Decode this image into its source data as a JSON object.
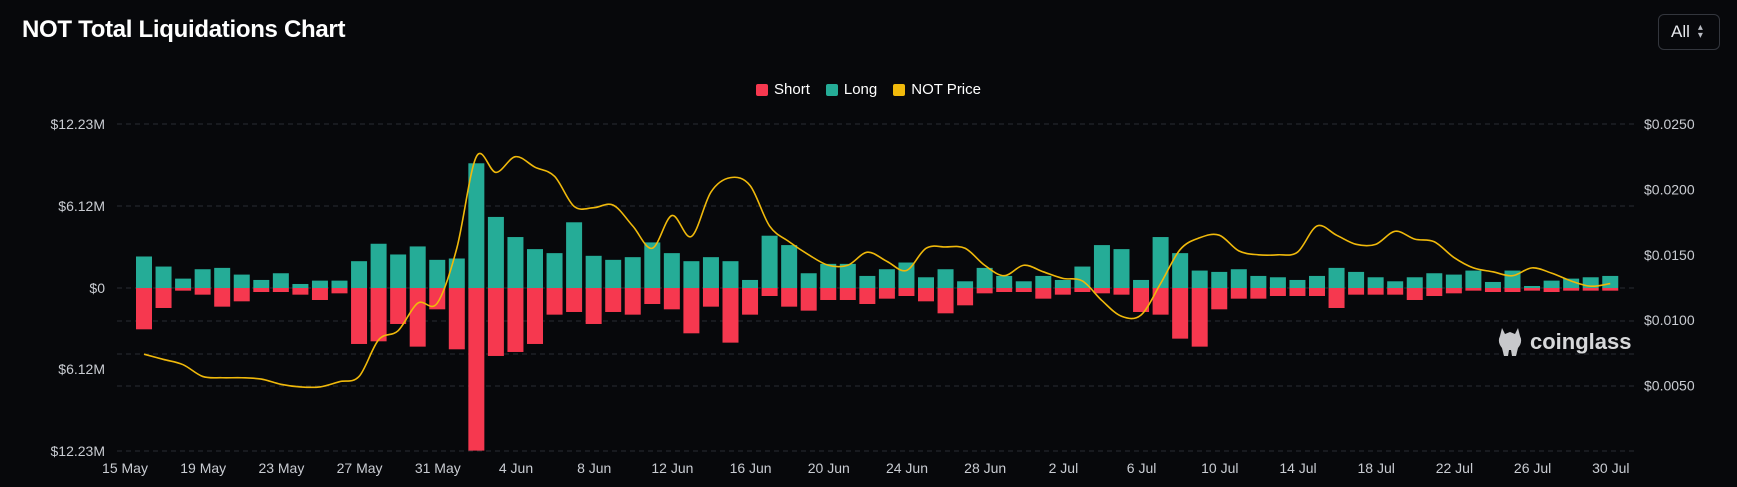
{
  "header": {
    "title": "NOT Total Liquidations Chart"
  },
  "range_select": {
    "value": "All"
  },
  "legend": [
    {
      "label": "Short",
      "color": "#f6384f"
    },
    {
      "label": "Long",
      "color": "#25ac97"
    },
    {
      "label": "NOT Price",
      "color": "#f0b90b"
    }
  ],
  "watermark": {
    "text": "coinglass"
  },
  "chart_data": {
    "type": "bar",
    "y_left": {
      "ticks": [
        "$12.23M",
        "$6.12M",
        "$0",
        "$6.12M",
        "$12.23M"
      ],
      "range": [
        -12.23,
        12.23
      ],
      "unit": "M USD"
    },
    "y_right": {
      "ticks": [
        "$0.0250",
        "$0.0200",
        "$0.0150",
        "$0.0100",
        "$0.0050"
      ],
      "range": [
        0.0,
        0.025
      ]
    },
    "x_ticks": [
      "15 May",
      "19 May",
      "23 May",
      "27 May",
      "31 May",
      "4 Jun",
      "8 Jun",
      "12 Jun",
      "16 Jun",
      "20 Jun",
      "24 Jun",
      "28 Jun",
      "2 Jul",
      "6 Jul",
      "10 Jul",
      "14 Jul",
      "18 Jul",
      "22 Jul",
      "26 Jul",
      "30 Jul"
    ],
    "x_tick_index": [
      0,
      4,
      8,
      12,
      16,
      20,
      24,
      28,
      32,
      36,
      40,
      44,
      48,
      52,
      56,
      60,
      64,
      68,
      72,
      76
    ],
    "series": [
      {
        "name": "Long",
        "color": "#25ac97",
        "values": [
          2.35,
          1.6,
          0.7,
          1.4,
          1.5,
          1.0,
          0.6,
          1.1,
          0.3,
          0.55,
          0.55,
          2.0,
          3.3,
          2.5,
          3.1,
          2.1,
          2.2,
          9.3,
          5.3,
          3.8,
          2.9,
          2.6,
          4.9,
          2.4,
          2.1,
          2.3,
          3.4,
          2.6,
          2.0,
          2.3,
          2.0,
          0.6,
          3.9,
          3.2,
          1.1,
          1.8,
          1.8,
          0.9,
          1.4,
          1.9,
          0.8,
          1.4,
          0.5,
          1.5,
          0.9,
          0.5,
          0.9,
          0.6,
          1.6,
          3.2,
          2.9,
          0.6,
          3.8,
          2.6,
          1.3,
          1.2,
          1.4,
          0.9,
          0.8,
          0.6,
          0.9,
          1.5,
          1.2,
          0.8,
          0.5,
          0.8,
          1.1,
          1.0,
          1.3,
          0.45,
          1.3,
          0.15,
          0.55,
          0.7,
          0.8,
          0.9
        ]
      },
      {
        "name": "Short",
        "color": "#f6384f",
        "values": [
          -3.1,
          -1.5,
          -0.2,
          -0.5,
          -1.4,
          -1.0,
          -0.3,
          -0.3,
          -0.5,
          -0.9,
          -0.4,
          -4.2,
          -4.0,
          -2.7,
          -4.4,
          -1.6,
          -4.6,
          -12.2,
          -5.1,
          -4.8,
          -4.2,
          -2.0,
          -1.8,
          -2.7,
          -1.8,
          -2.0,
          -1.2,
          -1.6,
          -3.4,
          -1.4,
          -4.1,
          -2.0,
          -0.6,
          -1.4,
          -1.7,
          -0.9,
          -0.9,
          -1.2,
          -0.8,
          -0.6,
          -1.0,
          -1.9,
          -1.3,
          -0.4,
          -0.3,
          -0.3,
          -0.8,
          -0.5,
          -0.3,
          -0.4,
          -0.5,
          -1.8,
          -2.0,
          -3.8,
          -4.4,
          -1.6,
          -0.8,
          -0.8,
          -0.6,
          -0.6,
          -0.6,
          -1.5,
          -0.5,
          -0.5,
          -0.5,
          -0.9,
          -0.6,
          -0.4,
          -0.2,
          -0.3,
          -0.3,
          -0.2,
          -0.3,
          -0.2,
          -0.2,
          -0.2
        ]
      },
      {
        "name": "NOT Price",
        "color": "#f0b90b",
        "values": [
          0.0074,
          0.007,
          0.0066,
          0.0057,
          0.0056,
          0.0056,
          0.0055,
          0.0051,
          0.0049,
          0.0049,
          0.0053,
          0.0057,
          0.0085,
          0.0092,
          0.0113,
          0.0113,
          0.0155,
          0.0225,
          0.0213,
          0.0225,
          0.0217,
          0.021,
          0.0187,
          0.0186,
          0.0188,
          0.0172,
          0.0155,
          0.018,
          0.0164,
          0.0198,
          0.0209,
          0.0203,
          0.0172,
          0.016,
          0.015,
          0.0142,
          0.0142,
          0.0152,
          0.0145,
          0.0138,
          0.0155,
          0.0156,
          0.0155,
          0.0142,
          0.0134,
          0.0142,
          0.0137,
          0.0132,
          0.013,
          0.0115,
          0.0103,
          0.0104,
          0.0128,
          0.0154,
          0.0163,
          0.0165,
          0.0153,
          0.015,
          0.015,
          0.0152,
          0.0172,
          0.0165,
          0.0158,
          0.0158,
          0.0168,
          0.0162,
          0.016,
          0.0148,
          0.014,
          0.0137,
          0.0134,
          0.014,
          0.0136,
          0.013,
          0.0126,
          0.0128
        ]
      }
    ],
    "grid": "dashed-horizontal",
    "legend_position": "top-center"
  }
}
